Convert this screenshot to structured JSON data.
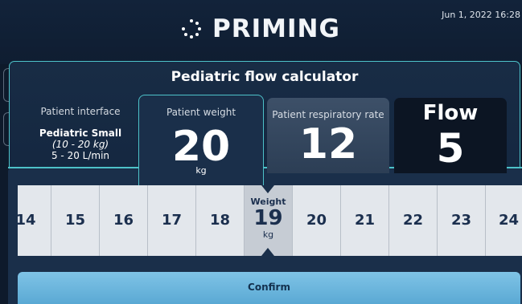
{
  "header": {
    "title": "PRIMING",
    "datetime": "Jun 1, 2022 16:28",
    "icon": "spinner-icon"
  },
  "calculator": {
    "title": "Pediatric flow calculator",
    "interface": {
      "label": "Patient interface",
      "name": "Pediatric Small",
      "range": "(10 - 20 kg)",
      "flow_range": "5 - 20 L/min"
    },
    "weight": {
      "label": "Patient weight",
      "value": "20",
      "unit": "kg"
    },
    "rate": {
      "label": "Patient respiratory rate",
      "value": "12"
    },
    "flow": {
      "label": "Flow",
      "value": "5"
    }
  },
  "picker": {
    "header": "Weight",
    "unit": "kg",
    "selected": "19",
    "values": [
      "14",
      "15",
      "16",
      "17",
      "18",
      "19",
      "20",
      "21",
      "22",
      "23",
      "24"
    ]
  },
  "actions": {
    "confirm": "Confirm"
  },
  "colors": {
    "accent": "#4dc2c9",
    "background": "#0e1a2b",
    "confirm": "#6bb6e0"
  }
}
